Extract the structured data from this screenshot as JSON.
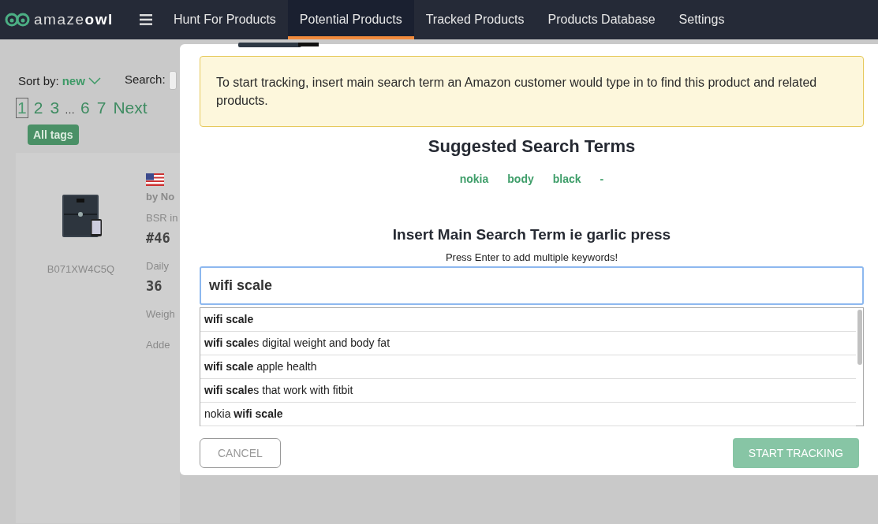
{
  "nav": {
    "logo": "amaze**owl**",
    "tabs": [
      {
        "label": "Hunt For Products",
        "selected": false
      },
      {
        "label": "Potential Products",
        "selected": true
      },
      {
        "label": "Tracked Products",
        "selected": false
      },
      {
        "label": "Products Database",
        "selected": false
      },
      {
        "label": "Settings",
        "selected": false
      }
    ]
  },
  "toolbar": {
    "sort_label": "Sort by:",
    "sort_value": "new",
    "search_label": "Search:"
  },
  "pagination": [
    {
      "label": "1",
      "selected": true
    },
    {
      "label": "2",
      "selected": false
    },
    {
      "label": "3",
      "selected": false
    },
    {
      "label": "…",
      "kind": "gap"
    },
    {
      "label": "6",
      "selected": false
    },
    {
      "label": "7",
      "selected": false
    },
    {
      "label": "Next",
      "selected": false
    }
  ],
  "tag_button": "All tags",
  "product": {
    "asin": "B071XW4C5Q",
    "brand": "by No",
    "bsr_label": "BSR in",
    "bsr_value": "#46",
    "daily_label": "Daily",
    "daily_value": "36",
    "weight_label": "Weigh",
    "added_label": "Adde"
  },
  "modal": {
    "notice": "To start tracking, insert main search term an Amazon customer would type in to find this product and related products.",
    "suggested_title": "Suggested Search Terms",
    "suggested_terms": [
      "nokia",
      "body",
      "black",
      "-"
    ],
    "input_title": "Insert Main Search Term ie garlic press",
    "input_hint": "Press Enter to add multiple keywords!",
    "input_value": "wifi scale",
    "suggestions": [
      "**wifi scale**",
      "**wifi scale**s digital weight and body fat",
      "**wifi scale** apple health",
      "**wifi scale**s that work with fitbit",
      "nokia **wifi scale**"
    ],
    "cancel": "CANCEL",
    "submit": "START TRACKING",
    "submit_disabled": true
  }
}
